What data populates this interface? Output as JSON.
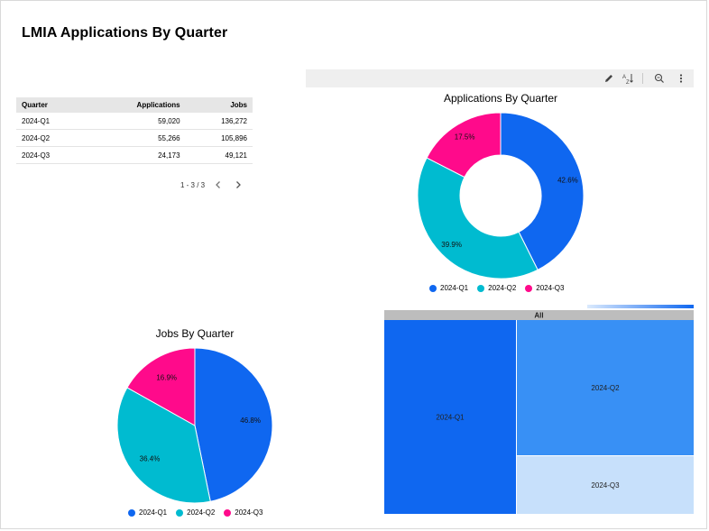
{
  "page": {
    "title": "LMIA Applications By Quarter"
  },
  "table": {
    "columns": [
      "Quarter",
      "Applications",
      "Jobs"
    ],
    "rows": [
      [
        "2024-Q1",
        "59,020",
        "136,272"
      ],
      [
        "2024-Q2",
        "55,266",
        "105,896"
      ],
      [
        "2024-Q3",
        "24,173",
        "49,121"
      ]
    ],
    "pagination": "1 - 3 / 3"
  },
  "toolbar": {
    "icons": [
      "pencil-icon",
      "sort-az-icon",
      "zoom-icon",
      "more-vert-icon"
    ]
  },
  "colors": {
    "q1": "#0f67f0",
    "q2": "#00bbd0",
    "q3": "#ff0a8b",
    "treemap_q2": "#3890f5",
    "treemap_q3": "#c7e0fb",
    "treemap_header": "#bdbdbd"
  },
  "chart_data": [
    {
      "type": "pie",
      "variant": "donut",
      "title": "Applications By Quarter",
      "categories": [
        "2024-Q1",
        "2024-Q2",
        "2024-Q3"
      ],
      "values": [
        59020,
        55266,
        24173
      ],
      "labels": [
        "42.6%",
        "39.9%",
        "17.5%"
      ],
      "legend_position": "bottom"
    },
    {
      "type": "pie",
      "title": "Jobs By Quarter",
      "categories": [
        "2024-Q1",
        "2024-Q2",
        "2024-Q3"
      ],
      "values": [
        136272,
        105896,
        49121
      ],
      "labels": [
        "46.8%",
        "36.4%",
        "16.9%"
      ],
      "legend_position": "bottom"
    },
    {
      "type": "treemap",
      "root": "All",
      "categories": [
        "2024-Q1",
        "2024-Q2",
        "2024-Q3"
      ],
      "values": [
        59020,
        55266,
        24173
      ]
    }
  ]
}
